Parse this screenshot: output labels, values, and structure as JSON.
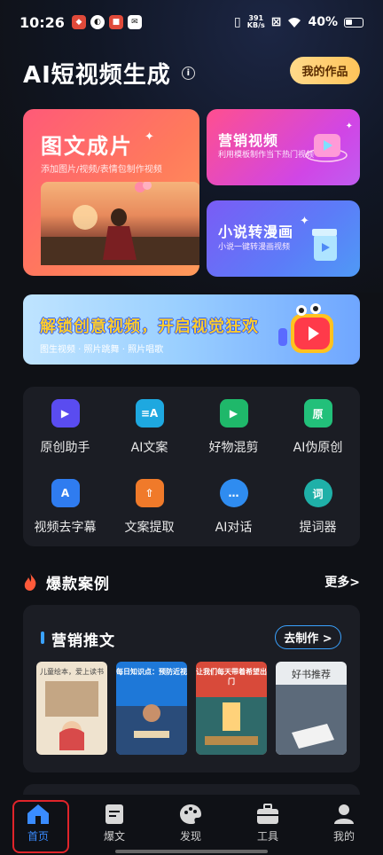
{
  "status_bar": {
    "time": "10:26",
    "net_speed_value": "391",
    "net_speed_unit": "KB/s",
    "battery": "40%"
  },
  "header": {
    "title": "AI短视频生成",
    "my_works": "我的作品"
  },
  "feature_cards": {
    "image_text": {
      "title": "图文成片",
      "desc": "添加图片/视频/表情包制作视频"
    },
    "marketing": {
      "title": "营销视频",
      "desc": "利用模板制作当下热门视频"
    },
    "novel": {
      "title": "小说转漫画",
      "desc": "小说一键转漫画视频"
    }
  },
  "promo_banner": {
    "title": "解锁创意视频，开启视觉狂欢",
    "subtitle": "图生视频 · 照片跳舞 · 照片唱歌"
  },
  "tools": [
    {
      "label": "原创助手",
      "icon": "video-camera-icon",
      "color": "#5a4cf0"
    },
    {
      "label": "AI文案",
      "icon": "ai-text-icon",
      "color": "#1ea8e0"
    },
    {
      "label": "好物混剪",
      "icon": "play-clip-icon",
      "color": "#1fb86a"
    },
    {
      "label": "AI伪原创",
      "icon": "original-doc-icon",
      "color": "#22c07a"
    },
    {
      "label": "视频去字幕",
      "icon": "subtitle-remove-icon",
      "color": "#2f7cf0"
    },
    {
      "label": "文案提取",
      "icon": "extract-upload-icon",
      "color": "#f07a2a"
    },
    {
      "label": "AI对话",
      "icon": "chat-bubble-icon",
      "color": "#2f8cf0"
    },
    {
      "label": "提词器",
      "icon": "teleprompter-icon",
      "color": "#1fb0a8"
    }
  ],
  "hot_cases": {
    "title": "爆款案例",
    "more": "更多>"
  },
  "marketing_case": {
    "title": "营销推文",
    "button": "去制作 >",
    "thumbs": [
      {
        "caption": "儿童绘本，爱上读书",
        "bg": "#efe3cf"
      },
      {
        "caption": "每日知识点：预防近视",
        "bg": "#1e78d8"
      },
      {
        "caption": "让我们每天带着希望出门",
        "bg": "#d84a3a"
      },
      {
        "caption": "好书推荐",
        "bg": "#e9ecef"
      }
    ]
  },
  "bottom_nav": [
    {
      "label": "首页",
      "icon": "home-icon",
      "active": true
    },
    {
      "label": "爆文",
      "icon": "article-icon",
      "active": false
    },
    {
      "label": "发现",
      "icon": "palette-icon",
      "active": false
    },
    {
      "label": "工具",
      "icon": "toolbox-icon",
      "active": false
    },
    {
      "label": "我的",
      "icon": "profile-icon",
      "active": false
    }
  ],
  "colors": {
    "background": "#0f1116",
    "panel": "#1b1d24",
    "accent_blue": "#3aa2ff",
    "active_nav": "#3a8cff",
    "highlight_box": "#e0242a"
  }
}
